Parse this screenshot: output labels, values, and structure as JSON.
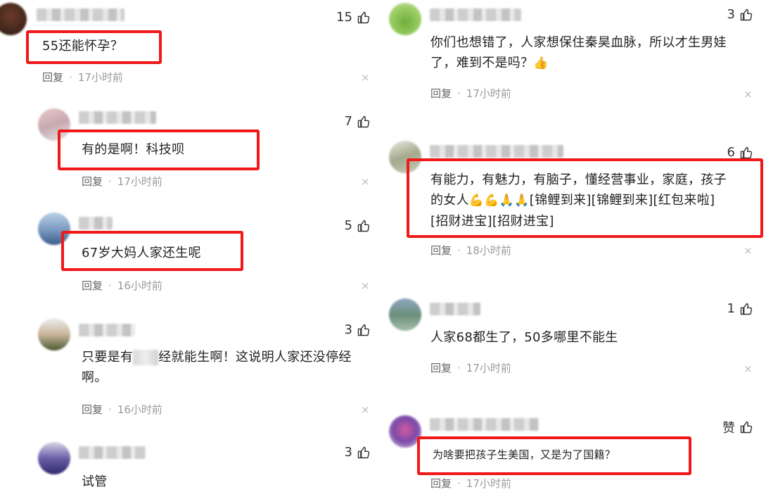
{
  "ui": {
    "reply_label": "回复",
    "separator": "·",
    "close_glyph": "×"
  },
  "left": [
    {
      "likes": "15",
      "text": "55还能怀孕？",
      "time": "17小时前"
    },
    {
      "likes": "7",
      "text": "有的是啊！科技呗",
      "time": "17小时前"
    },
    {
      "likes": "5",
      "text": "67岁大妈人家还生呢",
      "time": "16小时前"
    },
    {
      "likes": "3",
      "text_pre": "只要是有",
      "text_post": "经就能生啊！这说明人家还没停经",
      "text_line2": "啊。",
      "time": "16小时前"
    },
    {
      "likes": "3",
      "text": "试管"
    }
  ],
  "right": [
    {
      "likes": "3",
      "text_line1": "你们也想错了，人家想保住秦昊血脉，所以才生男娃",
      "text_line2": "了，难到不是吗？",
      "emoji": "👍",
      "time": "17小时前"
    },
    {
      "likes": "6",
      "text_line1": "有能力，有魅力，有脑子，懂经营事业，家庭，孩子",
      "text_line2_pre": "的女人",
      "emoji_row": "💪💪🙏🙏",
      "text_line2_post": "[锦鲤到来][锦鲤到来][红包来啦]",
      "text_line3": "[招财进宝][招财进宝]",
      "time": "18小时前"
    },
    {
      "likes": "1",
      "text": "人家68都生了，50多哪里不能生",
      "time": "17小时前"
    },
    {
      "likes": "赞",
      "text": "为啥要把孩子生美国，又是为了国籍？",
      "time": "17小时前"
    }
  ]
}
